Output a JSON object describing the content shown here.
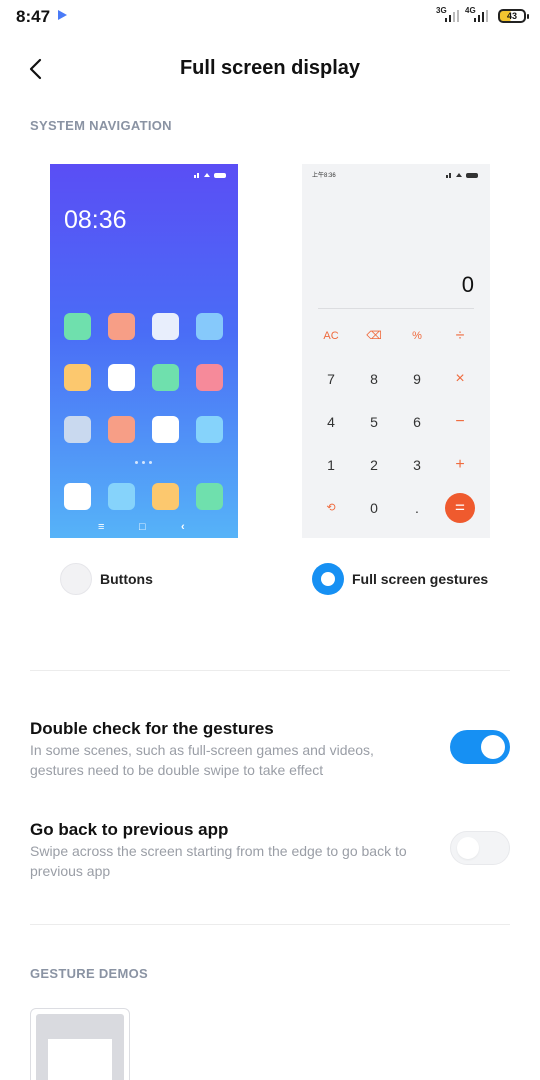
{
  "status_bar": {
    "time": "8:47",
    "network_1": "3G",
    "network_2": "4G",
    "battery": "43"
  },
  "header": {
    "title": "Full screen display"
  },
  "system_navigation": {
    "section_label": "SYSTEM NAVIGATION",
    "buttons_preview": {
      "time": "08:36",
      "nav_keys": [
        "≡",
        "□",
        "‹"
      ]
    },
    "gestures_preview": {
      "status_text": "上午8:36",
      "display_value": "0",
      "keys": [
        [
          "AC",
          "⌫",
          "%",
          "÷"
        ],
        [
          "7",
          "8",
          "9",
          "×"
        ],
        [
          "4",
          "5",
          "6",
          "−"
        ],
        [
          "1",
          "2",
          "3",
          "+"
        ],
        [
          "⟲",
          "0",
          ".",
          "="
        ]
      ]
    },
    "options": [
      {
        "label": "Buttons",
        "selected": false
      },
      {
        "label": "Full screen gestures",
        "selected": true
      }
    ]
  },
  "settings": [
    {
      "title": "Double check for the gestures",
      "description": "In some scenes, such as full-screen games and videos, gestures need to be double swipe to take effect",
      "enabled": true
    },
    {
      "title": "Go back to previous app",
      "description": "Swipe across the screen starting from the edge to go back to previous app",
      "enabled": false
    }
  ],
  "gesture_demos": {
    "section_label": "GESTURE DEMOS"
  },
  "colors": {
    "accent": "#1690f3",
    "section_label": "#8a93a3",
    "calculator_operator": "#ef6a3d"
  }
}
